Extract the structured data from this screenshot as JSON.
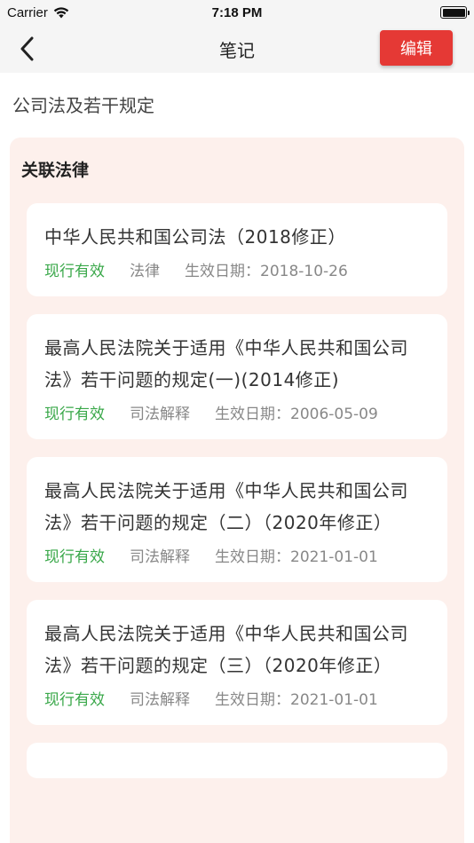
{
  "status_bar": {
    "carrier": "Carrier",
    "time": "7:18 PM",
    "battery_level": 1.0
  },
  "nav": {
    "title": "笔记",
    "edit_label": "编辑",
    "back_icon": "chevron-left-icon"
  },
  "note": {
    "title": "公司法及若干规定"
  },
  "related": {
    "heading": "关联法律",
    "items": [
      {
        "name": "中华人民共和国公司法（2018修正）",
        "status": "现行有效",
        "type": "法律",
        "effective": "生效日期：2018-10-26"
      },
      {
        "name": "最高人民法院关于适用《中华人民共和国公司法》若干问题的规定(一)(2014修正)",
        "status": "现行有效",
        "type": "司法解释",
        "effective": "生效日期：2006-05-09"
      },
      {
        "name": "最高人民法院关于适用《中华人民共和国公司法》若干问题的规定（二）（2020年修正）",
        "status": "现行有效",
        "type": "司法解释",
        "effective": "生效日期：2021-01-01"
      },
      {
        "name": "最高人民法院关于适用《中华人民共和国公司法》若干问题的规定（三）（2020年修正）",
        "status": "现行有效",
        "type": "司法解释",
        "effective": "生效日期：2021-01-01"
      }
    ]
  },
  "colors": {
    "accent": "#e53935",
    "status_green": "#3aa84a",
    "panel_bg": "#fdf0ec"
  }
}
